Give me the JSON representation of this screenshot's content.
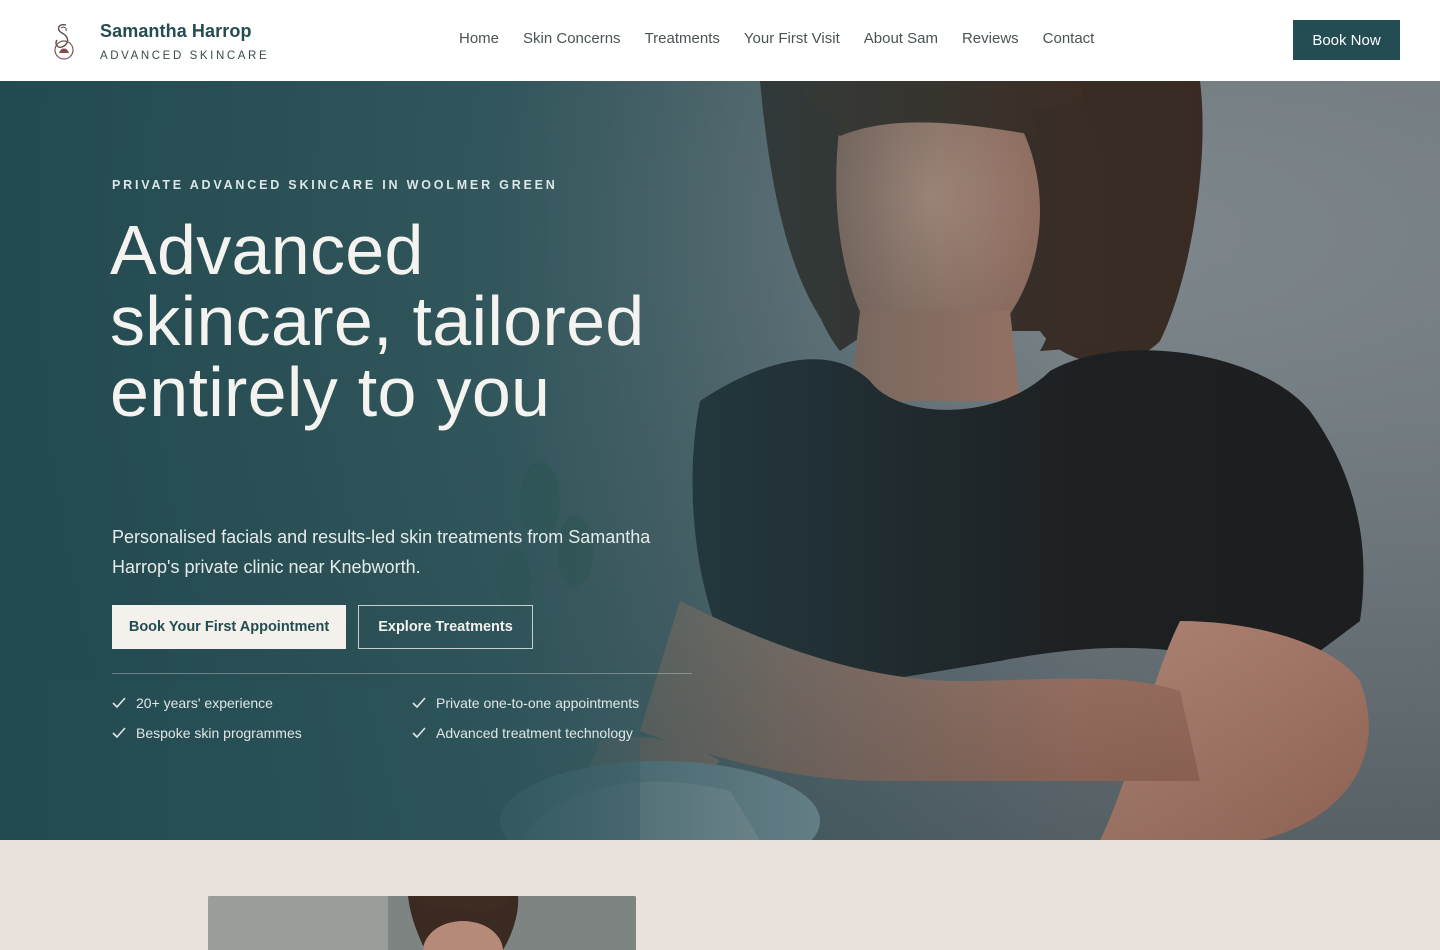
{
  "header": {
    "brand_name": "Samantha Harrop",
    "brand_sub": "ADVANCED SKINCARE",
    "nav": [
      "Home",
      "Skin Concerns",
      "Treatments",
      "Your First Visit",
      "About Sam",
      "Reviews",
      "Contact"
    ],
    "book_now_label": "Book Now"
  },
  "hero": {
    "eyebrow": "PRIVATE ADVANCED SKINCARE IN WOOLMER GREEN",
    "headline": "Advanced skincare, tailored entirely to you",
    "subtext": "Personalised facials and results-led skin treatments from Samantha Harrop's private clinic near Knebworth.",
    "primary_cta": "Book Your First Appointment",
    "secondary_cta": "Explore Treatments",
    "features": [
      "20+ years' experience",
      "Private one-to-one appointments",
      "Bespoke skin programmes",
      "Advanced treatment technology"
    ]
  },
  "colors": {
    "brand_teal": "#234d52",
    "hero_overlay": "#1e484e",
    "cream_button": "#f4f1ec",
    "lower_bg": "#e9e1db"
  },
  "icons": [
    "monogram-logo-icon",
    "check-icon"
  ]
}
